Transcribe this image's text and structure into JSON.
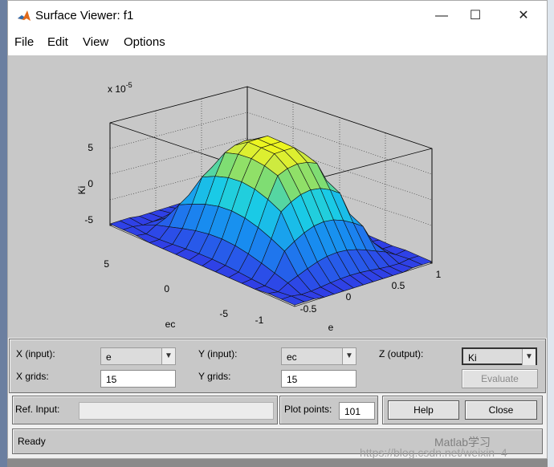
{
  "window": {
    "title": "Surface Viewer: f1",
    "controls": {
      "minimize": "—",
      "maximize": "☐",
      "close": "✕"
    }
  },
  "menu": [
    "File",
    "Edit",
    "View",
    "Options"
  ],
  "plot": {
    "exponent_base": "x 10",
    "exponent_power": "-5",
    "z_label": "Ki",
    "x_label": "e",
    "y_label": "ec",
    "z_ticks": [
      "5",
      "0",
      "-5"
    ],
    "x_ticks": [
      "-1",
      "-0.5",
      "0",
      "0.5",
      "1"
    ],
    "y_ticks": [
      "5",
      "0",
      "-5"
    ],
    "z_range": [
      -8,
      8
    ]
  },
  "chart_data": {
    "type": "surface",
    "x_range": [
      -1,
      1
    ],
    "y_range": [
      -6,
      6
    ],
    "z_range_note": "x 10^-5",
    "z_peak": 7.5,
    "z_min": -7.5,
    "grid": true,
    "colormap": "parula"
  },
  "controls": {
    "x_input_label": "X (input):",
    "x_input_value": "e",
    "y_input_label": "Y (input):",
    "y_input_value": "ec",
    "z_output_label": "Z (output):",
    "z_output_value": "Ki",
    "x_grids_label": "X grids:",
    "x_grids_value": "15",
    "y_grids_label": "Y grids:",
    "y_grids_value": "15",
    "evaluate_label": "Evaluate",
    "ref_input_label": "Ref. Input:",
    "ref_input_value": "",
    "plot_points_label": "Plot points:",
    "plot_points_value": "101",
    "help_label": "Help",
    "close_label": "Close",
    "status": "Ready"
  },
  "overlay": {
    "watermark": "https://blog.csdn.net/weixin_4",
    "wechat": "Matlab学习"
  }
}
